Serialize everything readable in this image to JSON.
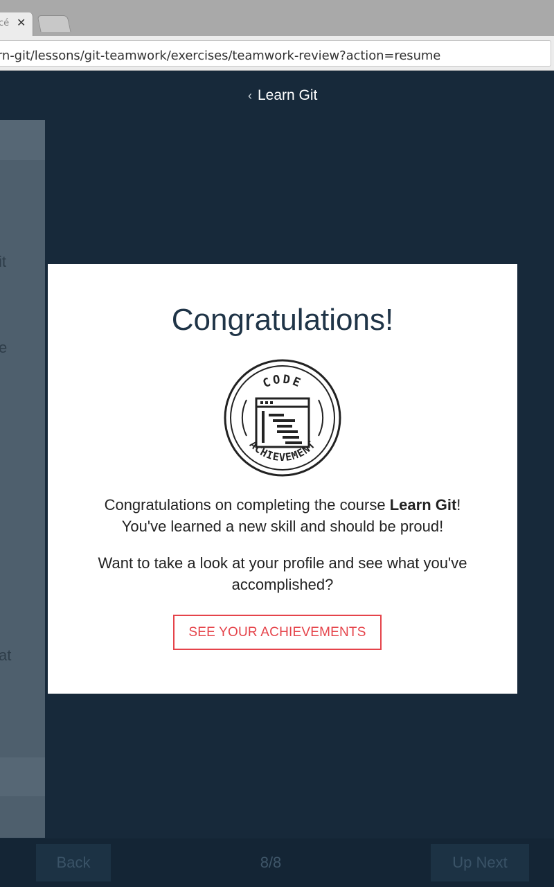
{
  "browser": {
    "tab_text": "cé",
    "tab_close": "✕",
    "url": "arn-git/lessons/git-teamwork/exercises/teamwork-review?action=resume"
  },
  "header": {
    "back_chevron": "‹",
    "course_title": "Learn Git"
  },
  "left_panel": {
    "fragments": [
      "it",
      "e",
      "at"
    ]
  },
  "modal": {
    "title": "Congratulations!",
    "badge": {
      "top_text": "CODE",
      "bottom_text": "ACHIEVEMENT",
      "icon": "code-window-icon"
    },
    "message_prefix": "Congratulations on completing the course ",
    "course_name": "Learn Git",
    "message_suffix": "!",
    "message_line2": "You've learned a new skill and should be proud!",
    "prompt": "Want to take a look at your profile and see what you've accomplished?",
    "cta_label": "SEE YOUR ACHIEVEMENTS"
  },
  "footer": {
    "back_label": "Back",
    "progress": "8/8",
    "next_label": "Up Next"
  },
  "colors": {
    "page_bg": "#17293a",
    "accent_red": "#e5434a",
    "title_navy": "#1f3447"
  }
}
